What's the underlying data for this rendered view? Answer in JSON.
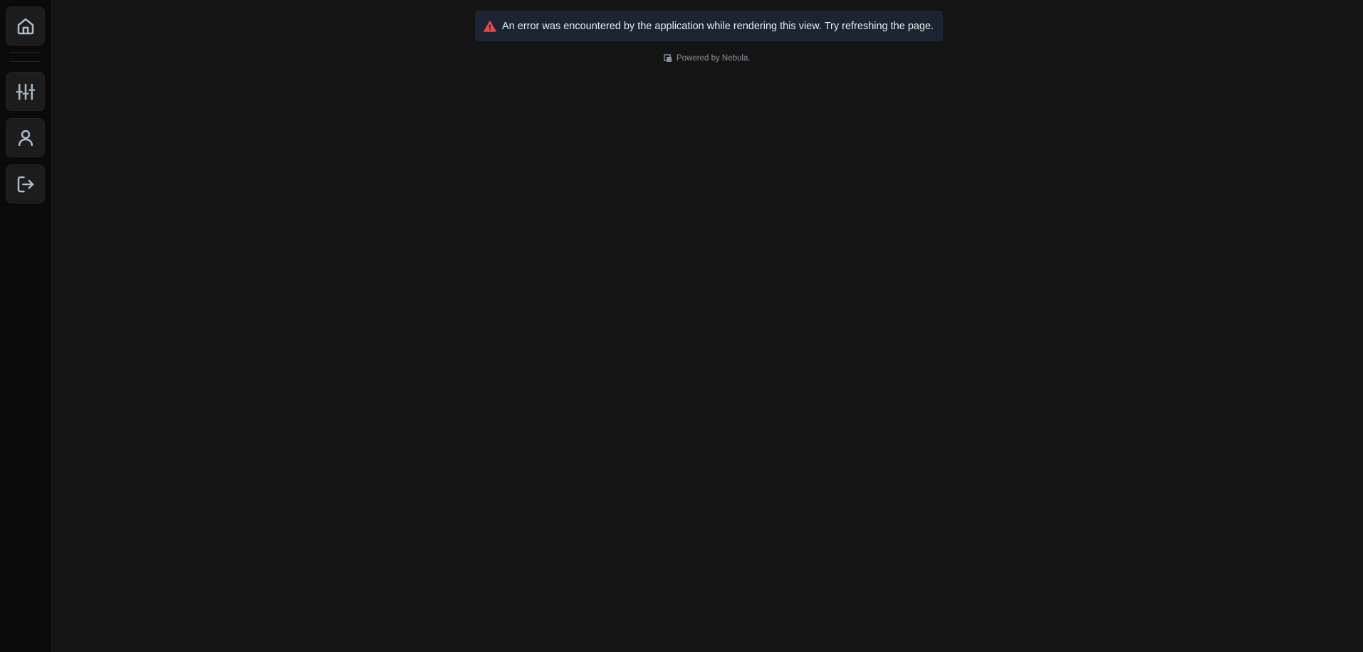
{
  "sidebar": {
    "items": [
      {
        "name": "home",
        "icon": "home-icon"
      },
      {
        "name": "settings",
        "icon": "sliders-icon"
      },
      {
        "name": "profile",
        "icon": "user-icon"
      },
      {
        "name": "logout",
        "icon": "logout-icon"
      }
    ]
  },
  "alert": {
    "icon": "warning-triangle-icon",
    "icon_color": "#e5484d",
    "message": "An error was encountered by the application while rendering this view. Try refreshing the page."
  },
  "footer": {
    "icon": "nebula-logo-icon",
    "powered_by": "Powered by Nebula."
  },
  "colors": {
    "background": "#141414",
    "sidebar": "#0a0a0a",
    "alert_background": "#1b2430",
    "icon_stroke": "#aebccb"
  }
}
